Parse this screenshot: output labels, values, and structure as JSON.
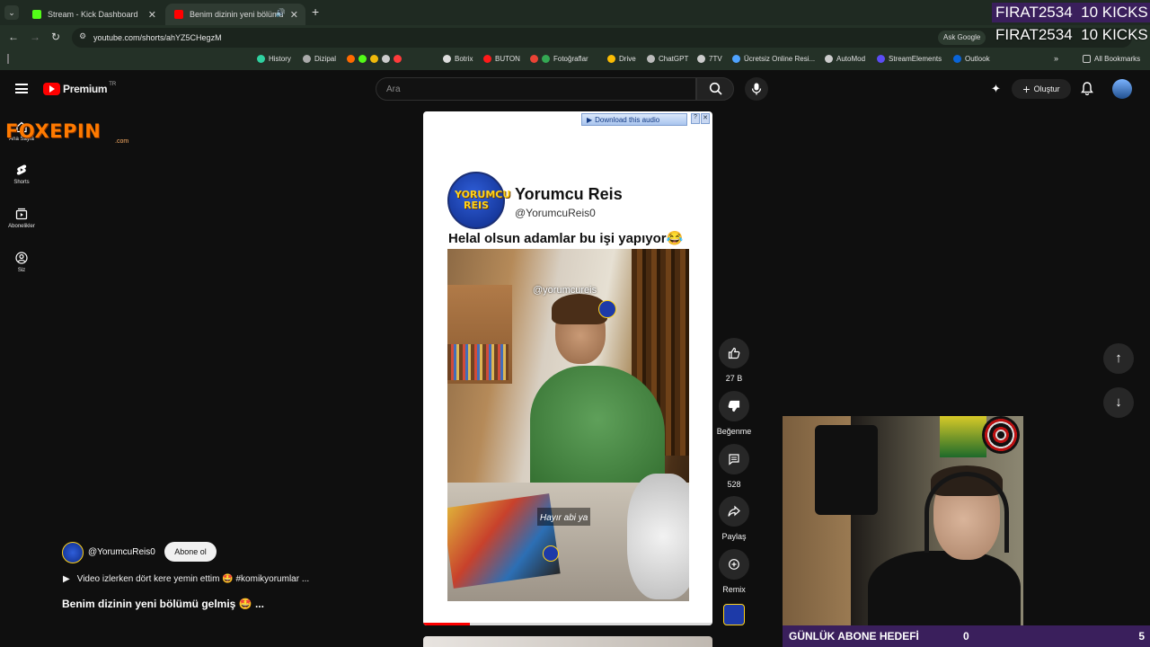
{
  "browser": {
    "tabs": [
      {
        "title": "Stream - Kick Dashboard",
        "active": false
      },
      {
        "title": "Benim dizinin yeni bölümü",
        "active": true
      }
    ],
    "url": "youtube.com/shorts/ahYZ5CHegzM",
    "ask_google": "Ask Google",
    "bookmarks": [
      "History",
      "Dizipal",
      "Botrix",
      "BUTON",
      "Fotoğraflar",
      "Drive",
      "ChatGPT",
      "7TV",
      "Ücretsiz Online Resi...",
      "AutoMod",
      "StreamElements",
      "Outlook"
    ],
    "all_bookmarks": "All Bookmarks"
  },
  "stream_overlay": {
    "top_line_1": "FIRAT2534  10 KICKS",
    "top_line_2": "FIRAT2534  10 KICKS",
    "logo": "FOXEPIN",
    "logo_sub": ".com",
    "goal_label": "GÜNLÜK ABONE HEDEFİ",
    "goal_current": "0",
    "goal_target": "5"
  },
  "youtube": {
    "logo_text": "Premium",
    "logo_badge": "TR",
    "search_placeholder": "Ara",
    "create_label": "Oluştur",
    "nav": [
      {
        "label": "Ana Sayfa",
        "icon": "home-icon"
      },
      {
        "label": "Shorts",
        "icon": "shorts-icon"
      },
      {
        "label": "Abonelikler",
        "icon": "subscriptions-icon"
      },
      {
        "label": "Siz",
        "icon": "you-icon"
      }
    ],
    "short": {
      "download_label": "Download this audio",
      "channel_title": "Yorumcu Reis",
      "channel_handle": "@YorumcuReis0",
      "avatar_text": "YORUMCU REIS",
      "headline": "Helal olsun adamlar bu işi yapıyor😂",
      "watermark": "@yorumcureis",
      "subtitle": "Hayır abi ya",
      "progress": 0.16
    },
    "actions": {
      "likes": "27 B",
      "dislike": "Beğenme",
      "comments": "528",
      "share": "Paylaş",
      "remix": "Remix"
    },
    "info": {
      "channel": "@YorumcuReis0",
      "subscribe": "Abone ol",
      "playlist": "Video izlerken dört kere yemin ettim 🤩 #komikyorumlar ...",
      "title": "Benim dizinin yeni bölümü gelmiş 🤩 ..."
    }
  },
  "colors": {
    "yt_red": "#ff0000",
    "tab_active": "#2f3b32",
    "goal_bar": "#3a1f5c",
    "kick_green": "#53fc18",
    "overlay_text": "#ffffff"
  }
}
